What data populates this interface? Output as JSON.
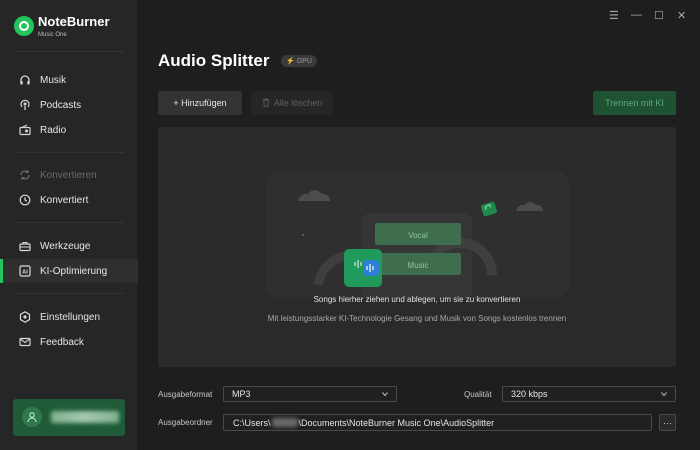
{
  "app": {
    "name": "NoteBurner",
    "subtitle": "Music One"
  },
  "window_controls": {
    "menu": "☰",
    "minimize": "—",
    "maximize": "☐",
    "close": "✕"
  },
  "sidebar": {
    "items": [
      {
        "label": "Musik",
        "icon": "headphones-icon"
      },
      {
        "label": "Podcasts",
        "icon": "podcast-icon"
      },
      {
        "label": "Radio",
        "icon": "radio-icon"
      },
      {
        "label": "Konvertieren",
        "icon": "convert-icon",
        "disabled": true
      },
      {
        "label": "Konvertiert",
        "icon": "clock-icon"
      },
      {
        "label": "Werkzeuge",
        "icon": "toolbox-icon"
      },
      {
        "label": "KI-Optimierung",
        "icon": "ai-icon",
        "active": true
      },
      {
        "label": "Einstellungen",
        "icon": "gear-icon"
      },
      {
        "label": "Feedback",
        "icon": "mail-icon"
      }
    ]
  },
  "page": {
    "title": "Audio Splitter",
    "badge": "GPU"
  },
  "toolbar": {
    "add_label": "+ Hinzufügen",
    "clear_label": "Alle löschen",
    "split_label": "Trennen mit KI"
  },
  "dropzone": {
    "vocal_label": "Vocal",
    "music_label": "Music",
    "main_text": "Songs hierher ziehen und ablegen, um sie zu konvertieren",
    "sub_text": "Mit leistungsstarker KI-Technologie Gesang und Musik von Songs kostenlos trennen"
  },
  "output": {
    "format_label": "Ausgabeformat",
    "format_value": "MP3",
    "quality_label": "Qualität",
    "quality_value": "320 kbps",
    "folder_label": "Ausgabeordner",
    "folder_prefix": "C:\\Users\\",
    "folder_suffix": "\\Documents\\NoteBurner Music One\\AudioSplitter",
    "more_label": "···"
  },
  "colors": {
    "accent": "#22c55e",
    "accent_dark": "#1e5232",
    "background": "#1e1e1e",
    "sidebar": "#262626"
  }
}
